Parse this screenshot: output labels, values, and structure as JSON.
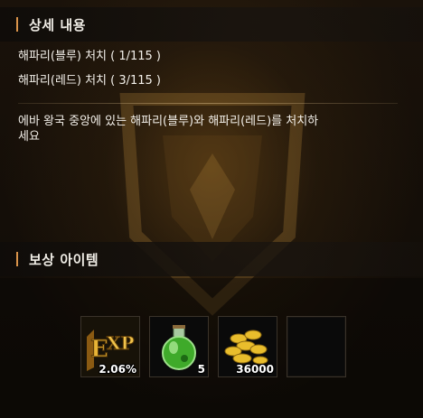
{
  "detail": {
    "title": "상세 내용",
    "goals": [
      "해파리(블루) 처치 ( 1/115 )",
      "해파리(레드) 처치 ( 3/115 )"
    ],
    "description": "에바 왕국 중앙에 있는 해파리(블루)와 해파리(레드)를 처치하\n세요"
  },
  "reward": {
    "title": "보상 아이템",
    "items": [
      {
        "icon": "exp-icon",
        "count": "2.06%"
      },
      {
        "icon": "green-potion-icon",
        "count": "5"
      },
      {
        "icon": "gold-coins-icon",
        "count": "36000"
      },
      {
        "icon": "empty-slot",
        "count": ""
      }
    ]
  },
  "colors": {
    "accent_bar": "#d9934a",
    "text": "#f3f0ea"
  }
}
